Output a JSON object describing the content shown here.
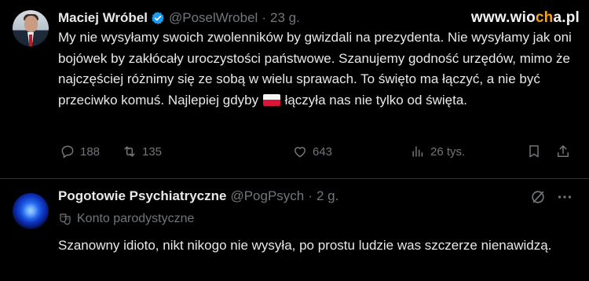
{
  "watermark": {
    "prefix": "www.wio",
    "highlight": "ch",
    "suffix": "a.pl"
  },
  "tweet1": {
    "author_name": "Maciej Wróbel",
    "handle": "@PoselWrobel",
    "separator": "·",
    "time": "23 g.",
    "text_before_flag": "My nie wysyłamy swoich zwolenników by gwizdali na prezydenta. Nie wysyłamy jak oni bojówek by zakłócały uroczystości państwowe. Szanujemy godność urzędów, mimo że najczęściej różnimy się ze sobą w wielu sprawach. To święto ma łączyć, a nie być przeciwko komuś. Najlepiej gdyby",
    "text_after_flag": "łączyła nas nie tylko od święta.",
    "replies": "188",
    "retweets": "135",
    "likes": "643",
    "views": "26 tys.",
    "verified_color": "#1d9bf0"
  },
  "tweet2": {
    "author_name": "Pogotowie Psychiatryczne",
    "handle": "@PogPsych",
    "separator": "·",
    "time": "2 g.",
    "parody_label": "Konto parodystyczne",
    "text": "Szanowny idioto, nikt nikogo nie wysyła, po prostu ludzie was szczerze nienawidzą."
  },
  "icons": {
    "reply": "reply-icon",
    "retweet": "retweet-icon",
    "like": "heart-icon",
    "views": "views-icon",
    "bookmark": "bookmark-icon",
    "share": "share-icon",
    "grok": "grok-icon",
    "more": "more-icon",
    "parody": "parody-mask-icon"
  },
  "colors": {
    "background": "#000000",
    "text": "#e7e9ea",
    "muted": "#71767b",
    "divider": "#2f3336",
    "accent": "#f2a51c"
  }
}
